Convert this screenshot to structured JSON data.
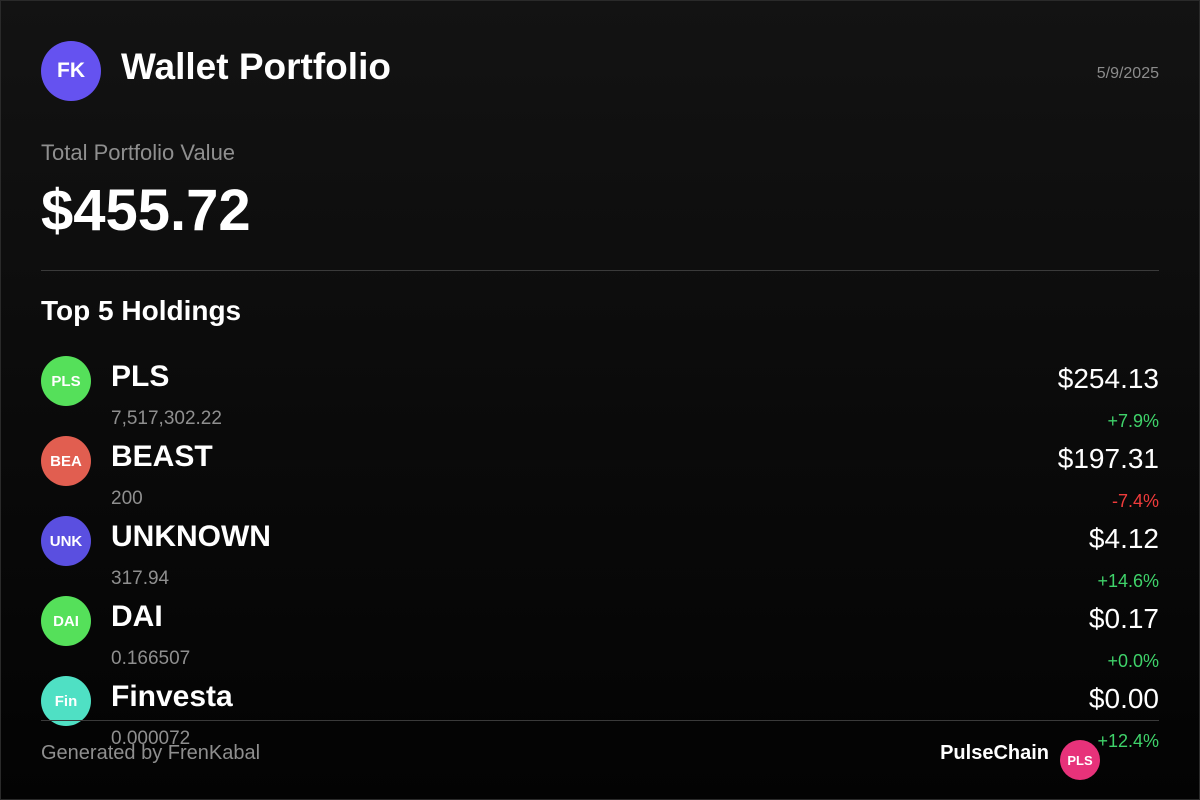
{
  "header": {
    "avatar_initials": "FK",
    "title": "Wallet Portfolio",
    "date": "5/9/2025"
  },
  "portfolio": {
    "total_label": "Total Portfolio Value",
    "total_value": "$455.72"
  },
  "holdings_section": {
    "title": "Top 5 Holdings",
    "items": [
      {
        "icon_text": "PLS",
        "icon_color": "#55e05a",
        "name": "PLS",
        "amount": "7,517,302.22",
        "value": "$254.13",
        "change": "+7.9%",
        "change_color": "#3fd36a"
      },
      {
        "icon_text": "BEA",
        "icon_color": "#e15e50",
        "name": "BEAST",
        "amount": "200",
        "value": "$197.31",
        "change": "-7.4%",
        "change_color": "#ef3b3b"
      },
      {
        "icon_text": "UNK",
        "icon_color": "#5a4fe0",
        "name": "UNKNOWN",
        "amount": "317.94",
        "value": "$4.12",
        "change": "+14.6%",
        "change_color": "#3fd36a"
      },
      {
        "icon_text": "DAI",
        "icon_color": "#55e05a",
        "name": "DAI",
        "amount": "0.166507",
        "value": "$0.17",
        "change": "+0.0%",
        "change_color": "#3fd36a"
      },
      {
        "icon_text": "Fin",
        "icon_color": "#4fe0c4",
        "name": "Finvesta",
        "amount": "0.000072",
        "value": "$0.00",
        "change": "+12.4%",
        "change_color": "#3fd36a"
      }
    ]
  },
  "footer": {
    "generated_by": "Generated by FrenKabal",
    "chain_name": "PulseChain",
    "chain_badge": "PLS",
    "chain_color": "#e7327a"
  }
}
